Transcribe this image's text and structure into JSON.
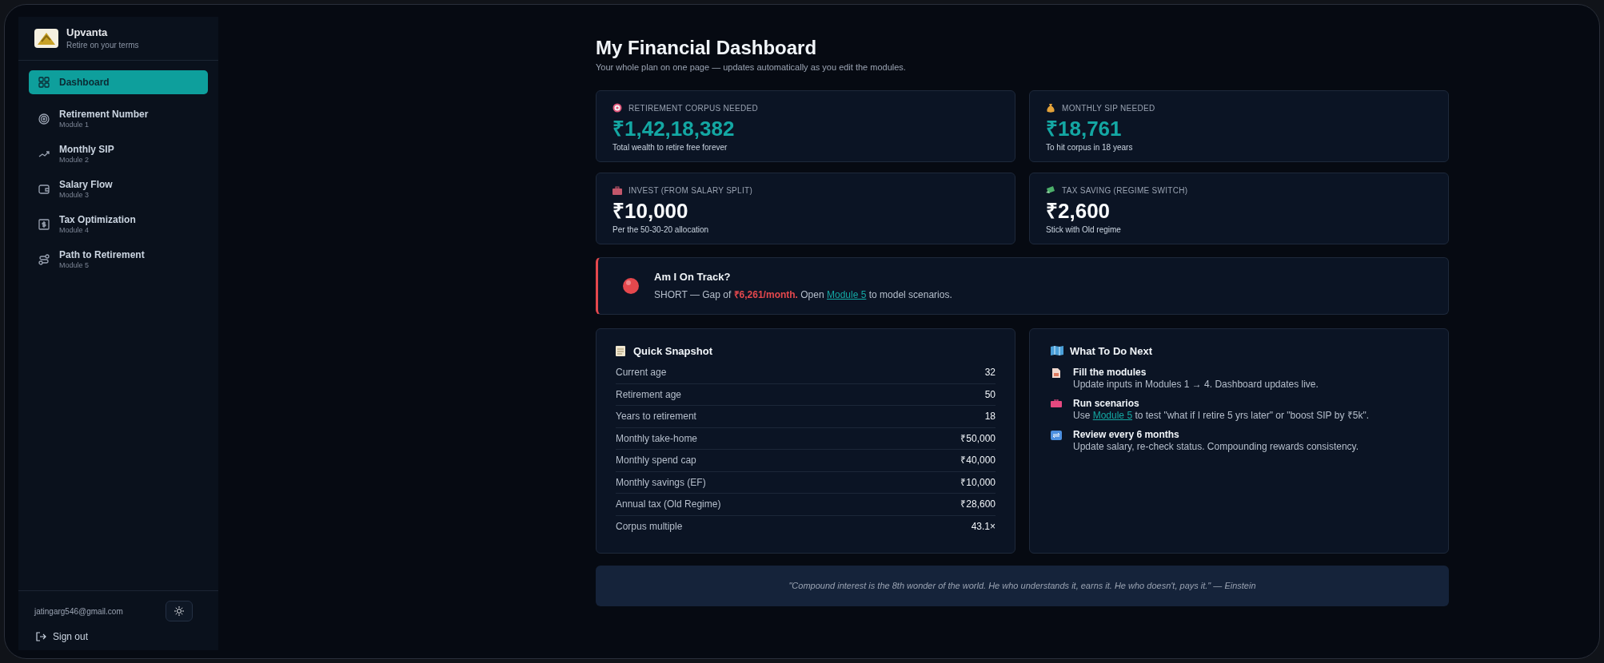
{
  "brand": {
    "name": "Upvanta",
    "tagline": "Retire on your terms"
  },
  "nav": [
    {
      "kind": "grid",
      "label": "Dashboard",
      "selected": true
    },
    {
      "kind": "target",
      "label": "Retirement Number",
      "sub": "Module 1",
      "selected": false
    },
    {
      "kind": "trend",
      "label": "Monthly SIP",
      "sub": "Module 2",
      "selected": false
    },
    {
      "kind": "wallet",
      "label": "Salary Flow",
      "sub": "Module 3",
      "selected": false
    },
    {
      "kind": "tax",
      "label": "Tax Optimization",
      "sub": "Module 4",
      "selected": false
    },
    {
      "kind": "route",
      "label": "Path to Retirement",
      "sub": "Module 5",
      "selected": false
    }
  ],
  "account": {
    "email": "jatingarg546@gmail.com",
    "sign_out": "Sign out"
  },
  "page": {
    "title": "My Financial Dashboard",
    "subtitle": "Your whole plan on one page — updates automatically as you edit the modules."
  },
  "stats": [
    {
      "kind": "target",
      "label": "RETIREMENT CORPUS NEEDED",
      "value": "₹1,42,18,382",
      "note": "Total wealth to retire free forever",
      "highlight": true
    },
    {
      "kind": "bag",
      "label": "MONTHLY SIP NEEDED",
      "value": "₹18,761",
      "note": "To hit corpus in 18 years",
      "highlight": true
    },
    {
      "kind": "briefcase",
      "label": "INVEST (FROM SALARY SPLIT)",
      "value": "₹10,000",
      "note": "Per the 50-30-20 allocation",
      "highlight": false
    },
    {
      "kind": "cash",
      "label": "TAX SAVING (REGIME SWITCH)",
      "value": "₹2,600",
      "note": "Stick with Old regime",
      "highlight": false
    }
  ],
  "track": {
    "title": "Am I On Track?",
    "on_track": false,
    "before": "SHORT — Gap of ",
    "gap": "₹6,261/month.",
    "middle": " Open ",
    "link": "Module 5",
    "after": " to model scenarios."
  },
  "snapshot": {
    "title": "Quick Snapshot",
    "rows": [
      {
        "label": "Current age",
        "value": "32"
      },
      {
        "label": "Retirement age",
        "value": "50"
      },
      {
        "label": "Years to retirement",
        "value": "18"
      },
      {
        "label": "Monthly take-home",
        "value": "₹50,000"
      },
      {
        "label": "Monthly spend cap",
        "value": "₹40,000"
      },
      {
        "label": "Monthly savings (EF)",
        "value": "₹10,000"
      },
      {
        "label": "Annual tax (Old Regime)",
        "value": "₹28,600"
      },
      {
        "label": "Corpus multiple",
        "value": "43.1×"
      }
    ]
  },
  "next": {
    "title": "What To Do Next",
    "items": [
      {
        "kind": "document",
        "title": "Fill the modules",
        "before": "Update inputs in Modules 1 → 4. Dashboard updates live."
      },
      {
        "kind": "toolbox",
        "title": "Run scenarios",
        "before": "Use ",
        "link": "Module 5",
        "after": " to test \"what if I retire 5 yrs later\" or \"boost SIP by ₹5k\"."
      },
      {
        "kind": "repeat",
        "title": "Review every 6 months",
        "before": "Update salary, re-check status. Compounding rewards consistency."
      }
    ]
  },
  "quote": "\"Compound interest is the 8th wonder of the world. He who understands it, earns it. He who doesn't, pays it.\" — Einstein"
}
